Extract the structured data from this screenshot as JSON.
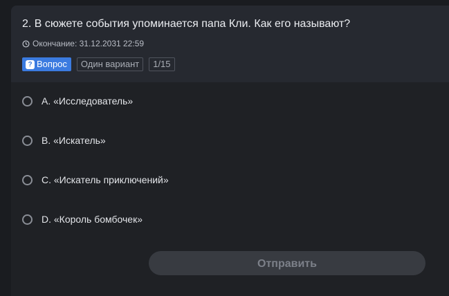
{
  "question": {
    "text": "2. В сюжете события упоминается папа Кли. Как его называют?",
    "deadline": "Окончание: 31.12.2031 22:59"
  },
  "tags": {
    "type": "Вопрос",
    "mode": "Один вариант",
    "counter": "1/15"
  },
  "options": [
    {
      "label": "A. «Исследователь»"
    },
    {
      "label": "B. «Искатель»"
    },
    {
      "label": "C. «Искатель приключений»"
    },
    {
      "label": "D. «Король бомбочек»"
    }
  ],
  "submit_label": "Отправить",
  "colors": {
    "accent": "#3b7be0",
    "background": "#1a1c20",
    "card_header": "#262930"
  }
}
